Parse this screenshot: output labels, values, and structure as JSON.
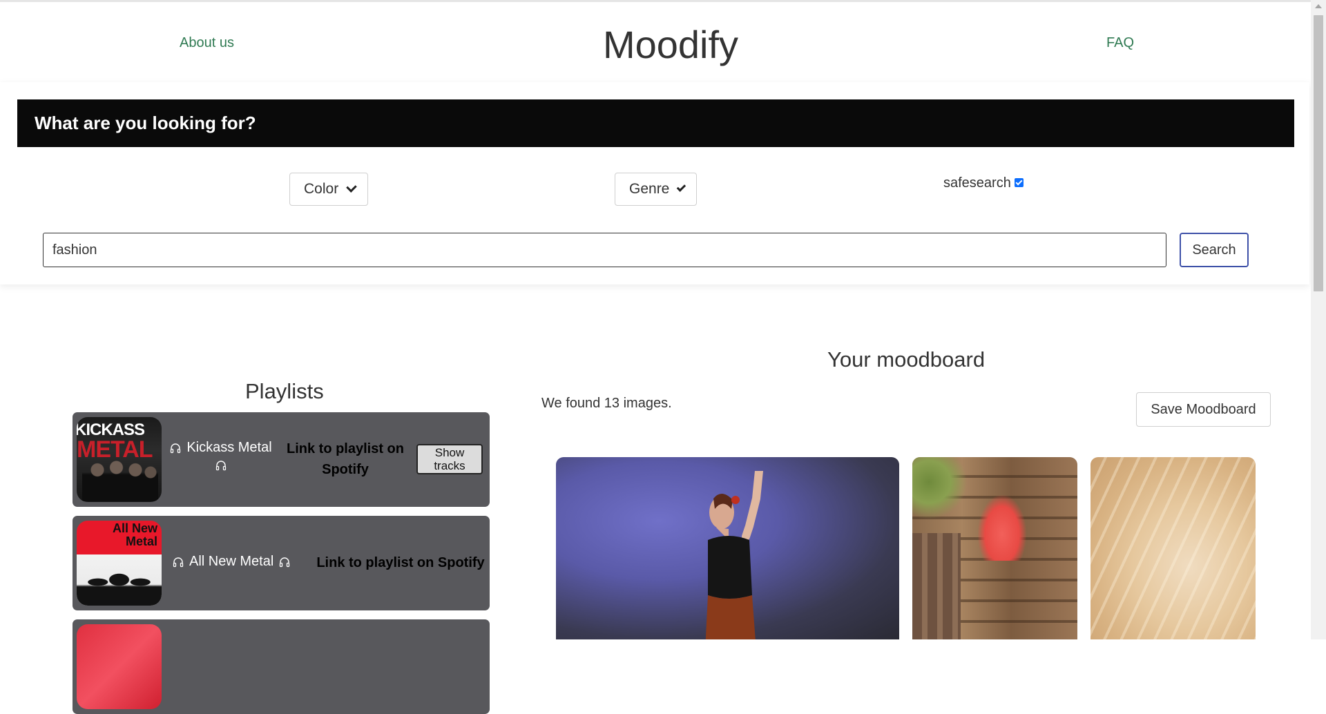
{
  "header": {
    "about_label": "About us",
    "brand": "Moodify",
    "faq_label": "FAQ"
  },
  "search": {
    "heading": "What are you looking for?",
    "color_select": "Color",
    "genre_select": "Genre",
    "safesearch_label": "safesearch",
    "safesearch_checked": true,
    "query_value": "fashion",
    "search_button": "Search"
  },
  "playlists": {
    "title": "Playlists",
    "items": [
      {
        "name": "Kickass Metal",
        "link_label": "Link to playlist on Spotify",
        "show_tracks_label": "Show tracks",
        "cover_text_top": "KICKASS",
        "cover_text_bottom": "METAL"
      },
      {
        "name": "All New Metal",
        "link_label": "Link to playlist on Spotify",
        "cover_text_top": "All New",
        "cover_text_bottom": "Metal"
      }
    ]
  },
  "moodboard": {
    "title": "Your moodboard",
    "found_text": "We found 13 images.",
    "save_button": "Save Moodboard"
  },
  "colors": {
    "nav_link": "#2f7a52",
    "question_bar": "#0a0a0a",
    "playlist_card": "#58585c",
    "search_button_border": "#3d50a8",
    "checkbox": "#0d6efd"
  }
}
